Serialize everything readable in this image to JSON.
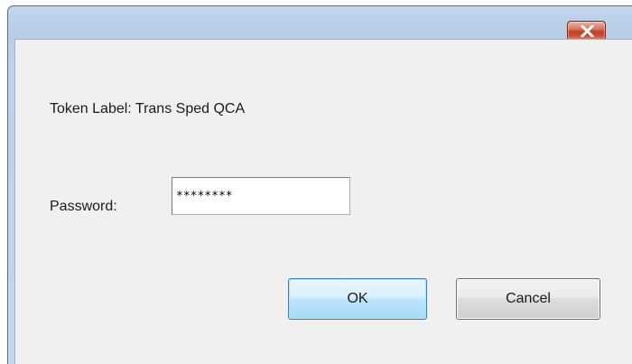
{
  "dialog": {
    "title": "",
    "token_label": "Token Label: Trans Sped QCA",
    "password_label": "Password:",
    "password_value": "********",
    "ok_label": "OK",
    "cancel_label": "Cancel"
  },
  "colors": {
    "titlebar": "#b9cee8",
    "client_bg": "#f0f0f0",
    "close_button": "#c7523a",
    "ok_border": "#3c7fb1"
  },
  "icons": {
    "close": "close-icon"
  }
}
